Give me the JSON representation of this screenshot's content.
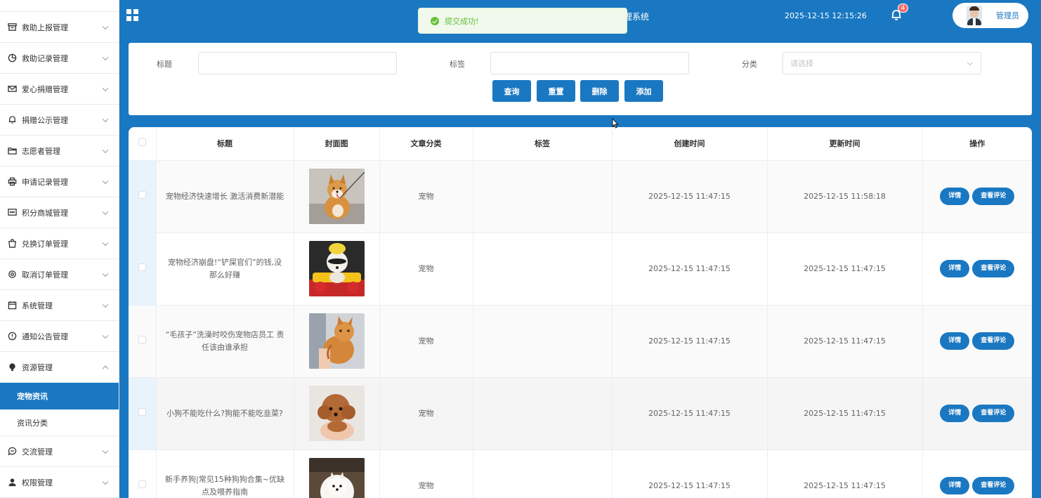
{
  "sidebar": {
    "partial_item": {
      "label": ""
    },
    "items": [
      {
        "label": "救助上报管理",
        "icon": "inbox-icon"
      },
      {
        "label": "救助记录管理",
        "icon": "pie-chart-icon"
      },
      {
        "label": "爱心捐赠管理",
        "icon": "mail-icon"
      },
      {
        "label": "捐赠公示管理",
        "icon": "bell-icon"
      },
      {
        "label": "志愿者管理",
        "icon": "folder-icon"
      },
      {
        "label": "申请记录管理",
        "icon": "printer-icon"
      },
      {
        "label": "积分商城管理",
        "icon": "chat-icon"
      },
      {
        "label": "兑换订单管理",
        "icon": "bag-icon"
      },
      {
        "label": "取消订单管理",
        "icon": "settings-icon"
      },
      {
        "label": "系统管理",
        "icon": "calendar-icon"
      },
      {
        "label": "通知公告管理",
        "icon": "info-icon"
      },
      {
        "label": "资源管理",
        "icon": "bulb-icon",
        "expanded": true
      }
    ],
    "sub_items": [
      {
        "label": "宠物资讯",
        "active": true
      },
      {
        "label": "资讯分类",
        "active": false
      }
    ],
    "bottom_items": [
      {
        "label": "交流管理",
        "icon": "chat-bubble-icon"
      },
      {
        "label": "权限管理",
        "icon": "user-icon"
      }
    ]
  },
  "header": {
    "title": "理系统",
    "datetime": "2025-12-15 12:15:26",
    "notification_count": "4",
    "user_name": "管理员"
  },
  "toast": {
    "message": "提交成功!"
  },
  "search": {
    "title_label": "标题",
    "tag_label": "标签",
    "category_label": "分类",
    "title_value": "",
    "tag_value": "",
    "category_placeholder": "请选择",
    "query_btn": "查询",
    "reset_btn": "重置",
    "delete_btn": "删除",
    "add_btn": "添加"
  },
  "table": {
    "headers": [
      "标题",
      "封面图",
      "文章分类",
      "标签",
      "创建时间",
      "更新时间",
      "操作"
    ],
    "detail_btn": "详情",
    "comments_btn": "查看评论",
    "rows": [
      {
        "title": "宠物经济快速增长 激活消费新潜能",
        "category": "宠物",
        "tags": "",
        "created": "2025-12-15 11:47:15",
        "updated": "2025-12-15 11:58:18",
        "cover": "shiba-dog"
      },
      {
        "title": "宠物经济崩盘!“铲屎官们”的钱,没那么好赚",
        "category": "宠物",
        "tags": "",
        "created": "2025-12-15 11:47:15",
        "updated": "2025-12-15 11:47:15",
        "cover": "dog-in-toy-car"
      },
      {
        "title": "“毛孩子”洗澡时咬伤宠物店员工 责任该由谁承担",
        "category": "宠物",
        "tags": "",
        "created": "2025-12-15 11:47:15",
        "updated": "2025-12-15 11:47:15",
        "cover": "orange-cat"
      },
      {
        "title": "小狗不能吃什么?狗能不能吃韭菜?",
        "category": "宠物",
        "tags": "",
        "created": "2025-12-15 11:47:15",
        "updated": "2025-12-15 11:47:15",
        "cover": "poodle-puppy"
      },
      {
        "title": "新手养狗|常见15种狗狗合集~优缺点及喂养指南",
        "category": "宠物",
        "tags": "",
        "created": "2025-12-15 11:47:15",
        "updated": "2025-12-15 11:47:15",
        "cover": "white-pomeranian"
      }
    ]
  },
  "colors": {
    "primary": "#1a78c2",
    "success": "#67c23a",
    "badge": "#f56c6c"
  }
}
